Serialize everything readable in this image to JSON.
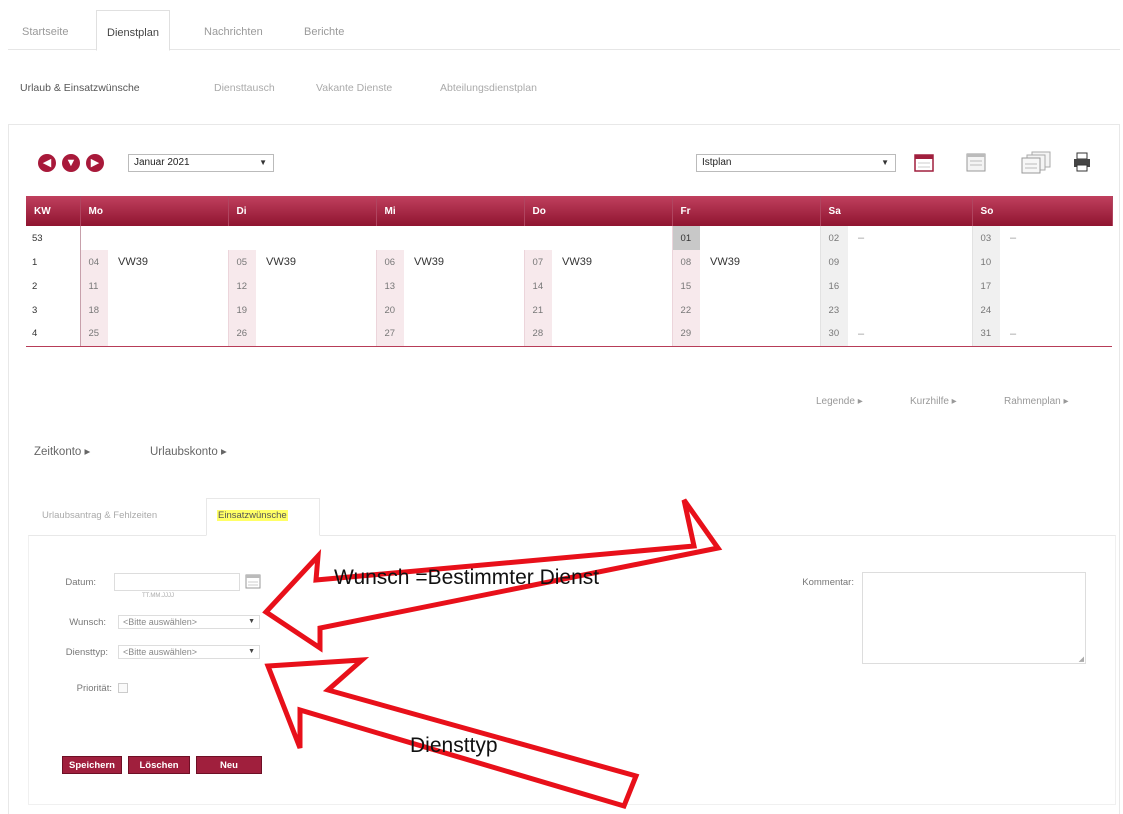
{
  "top_tabs": [
    "Startseite",
    "Dienstplan",
    "Nachrichten",
    "Berichte"
  ],
  "sub_tabs": [
    "Urlaub & Einsatzwünsche",
    "Diensttausch",
    "Vakante Dienste",
    "Abteilungsdienstplan"
  ],
  "toolbar": {
    "month_value": "Januar 2021",
    "plan_value": "Istplan",
    "icons": [
      "back-icon",
      "down-icon",
      "forward-icon",
      "calendar-icon",
      "list-icon",
      "multi-list-icon",
      "print-icon"
    ]
  },
  "calendar": {
    "headers": [
      "KW",
      "Mo",
      "Di",
      "Mi",
      "Do",
      "Fr",
      "Sa",
      "So"
    ],
    "rows": [
      {
        "kw": "53",
        "days": [
          [
            "",
            ""
          ],
          [
            "",
            ""
          ],
          [
            "",
            ""
          ],
          [
            "",
            ""
          ],
          [
            "01",
            ""
          ],
          [
            "02",
            "–"
          ],
          [
            "03",
            "–"
          ]
        ]
      },
      {
        "kw": "1",
        "days": [
          [
            "04",
            "VW39"
          ],
          [
            "05",
            "VW39"
          ],
          [
            "06",
            "VW39"
          ],
          [
            "07",
            "VW39"
          ],
          [
            "08",
            "VW39"
          ],
          [
            "09",
            ""
          ],
          [
            "10",
            ""
          ]
        ]
      },
      {
        "kw": "2",
        "days": [
          [
            "11",
            ""
          ],
          [
            "12",
            ""
          ],
          [
            "13",
            ""
          ],
          [
            "14",
            ""
          ],
          [
            "15",
            ""
          ],
          [
            "16",
            ""
          ],
          [
            "17",
            ""
          ]
        ]
      },
      {
        "kw": "3",
        "days": [
          [
            "18",
            ""
          ],
          [
            "19",
            ""
          ],
          [
            "20",
            ""
          ],
          [
            "21",
            ""
          ],
          [
            "22",
            ""
          ],
          [
            "23",
            ""
          ],
          [
            "24",
            ""
          ]
        ]
      },
      {
        "kw": "4",
        "days": [
          [
            "25",
            ""
          ],
          [
            "26",
            ""
          ],
          [
            "27",
            ""
          ],
          [
            "28",
            ""
          ],
          [
            "29",
            ""
          ],
          [
            "30",
            "–"
          ],
          [
            "31",
            "–"
          ]
        ]
      }
    ]
  },
  "links": {
    "legende": "Legende ▸",
    "kurzhilfe": "Kurzhilfe ▸",
    "rahmenplan": "Rahmenplan ▸"
  },
  "accounts": {
    "zeitkonto": "Zeitkonto ▸",
    "urlaubskonto": "Urlaubskonto ▸"
  },
  "lower_tabs": {
    "urlaubsantrag": "Urlaubsantrag & Fehlzeiten",
    "einsatzwuensche": "Einsatzwünsche"
  },
  "form": {
    "datum_label": "Datum:",
    "datum_hint": "TT.MM.JJJJ",
    "wunsch_label": "Wunsch:",
    "wunsch_value": "<Bitte auswählen>",
    "diensttyp_label": "Diensttyp:",
    "diensttyp_value": "<Bitte auswählen>",
    "prioritaet_label": "Priorität:",
    "kommentar_label": "Kommentar:"
  },
  "buttons": {
    "speichern": "Speichern",
    "loeschen": "Löschen",
    "neu": "Neu"
  },
  "annotations": {
    "wunsch": "Wunsch =Bestimmter Dienst",
    "diensttyp": "Diensttyp"
  },
  "colors": {
    "brand": "#a01f3d",
    "annotation_arrow": "#e8101a",
    "highlight": "#ffff66"
  }
}
